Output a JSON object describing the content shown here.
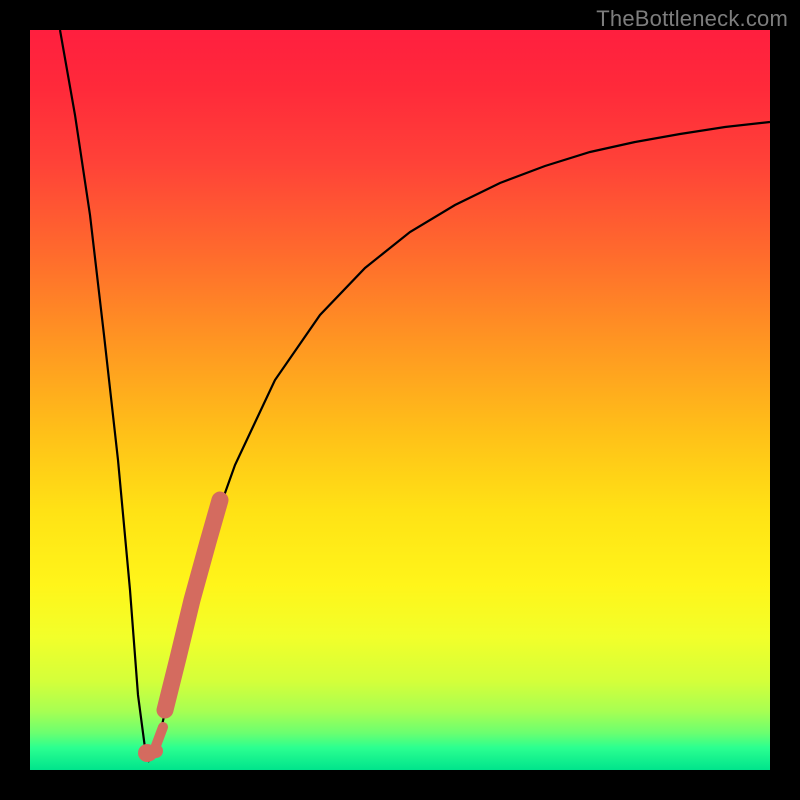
{
  "watermark": "TheBottleneck.com",
  "colors": {
    "frame": "#000000",
    "curve": "#000000",
    "marker_fill": "#d36a5e",
    "marker_stroke": "#b94f44"
  },
  "chart_data": {
    "type": "line",
    "title": "",
    "xlabel": "",
    "ylabel": "",
    "xlim": [
      0,
      100
    ],
    "ylim": [
      0,
      100
    ],
    "grid": false,
    "x": [
      0,
      2,
      4,
      6,
      8,
      10,
      11,
      12,
      13,
      14,
      16,
      18,
      20,
      22,
      25,
      30,
      35,
      40,
      45,
      50,
      55,
      60,
      65,
      70,
      75,
      80,
      85,
      90,
      95,
      100
    ],
    "values": [
      100,
      84,
      68,
      52,
      36,
      18,
      6,
      0,
      3,
      8,
      17,
      25,
      32,
      38,
      46,
      56,
      64,
      70,
      74.5,
      78,
      81,
      83.5,
      85.5,
      87,
      88.3,
      89.3,
      90.1,
      90.8,
      91.3,
      91.7
    ],
    "highlight_segment": {
      "x_start": 14.5,
      "x_end": 20,
      "note": "thick salmon overlay on rising branch"
    },
    "min_point": {
      "x": 12,
      "y": 0
    }
  }
}
